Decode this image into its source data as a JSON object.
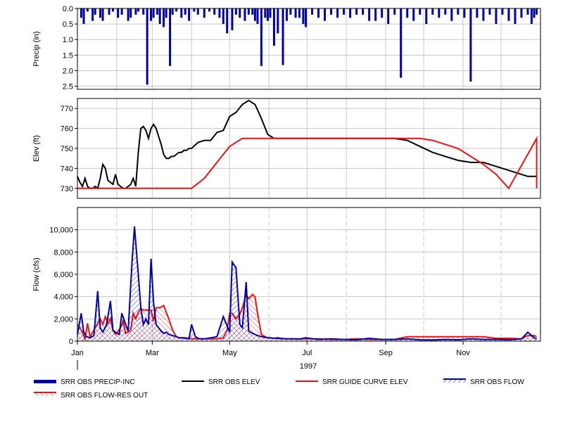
{
  "chart_data": [
    {
      "id": "precip",
      "type": "bar",
      "ylabel": "Precip (in)",
      "ylim": [
        0,
        2.6
      ],
      "y_inverted": true,
      "yticks": [
        "0.0",
        "0.5",
        "1.0",
        "1.5",
        "2.0",
        "2.5"
      ],
      "ytick_values": [
        0,
        0.5,
        1.0,
        1.5,
        2.0,
        2.5
      ],
      "grid": true,
      "color": "#0000a8",
      "series": [
        {
          "name": "SRR OBS PRECIP-INC",
          "x": [
            3,
            5,
            8,
            12,
            14,
            18,
            20,
            25,
            28,
            32,
            35,
            40,
            42,
            46,
            48,
            52,
            55,
            58,
            60,
            63,
            65,
            68,
            70,
            73,
            75,
            78,
            82,
            85,
            88,
            92,
            95,
            100,
            104,
            108,
            112,
            115,
            118,
            122,
            125,
            128,
            132,
            135,
            138,
            140,
            142,
            145,
            148,
            150,
            152,
            155,
            158,
            162,
            165,
            168,
            172,
            175,
            178,
            180,
            185,
            190,
            195,
            200,
            205,
            210,
            215,
            220,
            225,
            230,
            235,
            240,
            245,
            250,
            255,
            260,
            265,
            270,
            275,
            280,
            285,
            290,
            295,
            300,
            305,
            310,
            315,
            320,
            325,
            330,
            335,
            340,
            345,
            350,
            355,
            358,
            360,
            362
          ],
          "values": [
            0.3,
            0.5,
            0.1,
            0.4,
            0.2,
            0.3,
            0.4,
            0.2,
            0.1,
            0.3,
            0.2,
            0.4,
            0.3,
            0.2,
            0.1,
            0.2,
            2.45,
            0.4,
            0.3,
            0.2,
            0.5,
            0.6,
            0.3,
            1.85,
            0.2,
            0.1,
            0.3,
            0.2,
            0.4,
            0.1,
            0.2,
            0.3,
            0.1,
            0.2,
            0.3,
            0.5,
            0.8,
            0.7,
            0.2,
            0.3,
            0.4,
            0.2,
            0.2,
            0.4,
            0.5,
            1.85,
            0.3,
            0.4,
            0.3,
            1.2,
            0.8,
            1.82,
            0.4,
            0.2,
            0.3,
            0.3,
            0.5,
            0.6,
            0.2,
            0.3,
            0.4,
            0.2,
            0.3,
            0.2,
            0.3,
            0.2,
            0.2,
            0.4,
            0.4,
            0.3,
            0.5,
            0.2,
            2.23,
            0.3,
            0.4,
            0.2,
            0.5,
            0.2,
            0.3,
            0.2,
            0.4,
            0.2,
            0.3,
            2.35,
            0.3,
            0.4,
            0.2,
            0.5,
            0.2,
            0.4,
            0.5,
            0.3,
            0.2,
            0.5,
            0.3,
            0.2
          ]
        }
      ]
    },
    {
      "id": "elev",
      "type": "line",
      "ylabel": "Elev (ft)",
      "ylim": [
        725,
        775
      ],
      "yticks": [
        "730",
        "740",
        "750",
        "760",
        "770"
      ],
      "ytick_values": [
        730,
        740,
        750,
        760,
        770
      ],
      "grid": true,
      "series": [
        {
          "name": "SRR OBS ELEV",
          "color": "#000000",
          "x": [
            0,
            2,
            4,
            6,
            8,
            10,
            12,
            14,
            16,
            18,
            20,
            22,
            24,
            28,
            30,
            32,
            34,
            36,
            38,
            40,
            42,
            44,
            46,
            48,
            50,
            52,
            54,
            56,
            58,
            60,
            62,
            64,
            66,
            68,
            70,
            72,
            74,
            76,
            78,
            80,
            82,
            84,
            86,
            88,
            90,
            95,
            100,
            105,
            110,
            115,
            120,
            125,
            130,
            135,
            140,
            145,
            150,
            155,
            160,
            165,
            170,
            175,
            180,
            185,
            190,
            195,
            200,
            210,
            220,
            230,
            240,
            250,
            260,
            270,
            280,
            290,
            300,
            310,
            320,
            330,
            340,
            350,
            355,
            360,
            362
          ],
          "values": [
            736,
            733,
            731,
            735,
            731,
            730,
            730,
            731,
            730,
            735,
            742,
            740,
            734,
            732,
            737,
            732,
            731,
            730,
            730,
            731,
            732,
            735,
            731,
            748,
            760,
            761,
            759,
            755,
            760,
            762,
            760,
            756,
            752,
            747,
            745,
            745,
            746,
            746,
            747,
            748,
            748,
            749,
            749,
            750,
            750,
            753,
            754,
            754,
            758,
            759,
            766,
            768,
            772,
            774,
            772,
            765,
            757,
            755,
            755,
            755,
            755,
            755,
            755,
            755,
            755,
            755,
            755,
            755,
            755,
            755,
            755,
            755,
            754,
            751,
            748,
            746,
            744,
            743,
            743,
            741,
            739,
            737,
            736,
            736,
            736
          ]
        },
        {
          "name": "SRR GUIDE CURVE ELEV",
          "color": "#ee1111",
          "x": [
            0,
            90,
            100,
            110,
            120,
            130,
            135,
            362,
            270,
            280,
            300,
            320,
            330,
            340,
            362
          ],
          "values": [
            730,
            730,
            735,
            743,
            751,
            755,
            755,
            755,
            755,
            754,
            750,
            742,
            737,
            730,
            730
          ]
        }
      ]
    },
    {
      "id": "flow",
      "type": "area",
      "ylabel": "Flow (cfs)",
      "ylim": [
        0,
        12000
      ],
      "yticks": [
        "0",
        "2,000",
        "4,000",
        "6,000",
        "8,000",
        "10,000"
      ],
      "ytick_values": [
        0,
        2000,
        4000,
        6000,
        8000,
        10000
      ],
      "grid": true,
      "x_categories": [
        "Jan",
        "Mar",
        "May",
        "Jul",
        "Sep",
        "Nov"
      ],
      "year": "1997",
      "series": [
        {
          "name": "SRR OBS FLOW",
          "color": "#0000a8",
          "x": [
            0,
            3,
            5,
            7,
            10,
            13,
            16,
            18,
            20,
            23,
            26,
            28,
            30,
            33,
            35,
            38,
            40,
            43,
            45,
            48,
            50,
            52,
            54,
            56,
            58,
            60,
            62,
            64,
            66,
            68,
            70,
            72,
            75,
            78,
            80,
            82,
            85,
            88,
            90,
            93,
            96,
            100,
            105,
            110,
            115,
            120,
            122,
            125,
            128,
            130,
            133,
            135,
            138,
            140,
            142,
            145,
            148,
            150,
            152,
            155,
            158,
            160,
            165,
            170,
            175,
            180,
            190,
            200,
            210,
            220,
            230,
            240,
            250,
            260,
            270,
            280,
            290,
            300,
            310,
            320,
            330,
            340,
            350,
            355,
            360,
            362
          ],
          "values": [
            600,
            2500,
            800,
            400,
            300,
            500,
            4500,
            1200,
            800,
            1500,
            3600,
            1000,
            800,
            600,
            2500,
            1500,
            900,
            7000,
            10300,
            6000,
            3000,
            1500,
            2000,
            1500,
            7400,
            3500,
            1500,
            1200,
            900,
            700,
            800,
            600,
            500,
            400,
            300,
            300,
            250,
            200,
            1500,
            400,
            200,
            200,
            300,
            400,
            2200,
            800,
            7100,
            6600,
            1500,
            1200,
            5300,
            900,
            700,
            600,
            500,
            400,
            350,
            300,
            300,
            250,
            300,
            250,
            200,
            200,
            180,
            300,
            150,
            200,
            150,
            120,
            250,
            150,
            150,
            200,
            120,
            100,
            150,
            120,
            200,
            150,
            150,
            120,
            200,
            800,
            300,
            200
          ]
        },
        {
          "name": "SRR OBS FLOW-RES OUT",
          "color": "#ee1111",
          "x": [
            0,
            2,
            4,
            6,
            8,
            10,
            14,
            18,
            20,
            22,
            24,
            26,
            28,
            30,
            32,
            34,
            36,
            38,
            40,
            42,
            44,
            46,
            48,
            50,
            52,
            55,
            58,
            60,
            62,
            65,
            68,
            70,
            72,
            75,
            78,
            80,
            85,
            90,
            100,
            110,
            115,
            118,
            120,
            122,
            125,
            128,
            130,
            133,
            135,
            138,
            140,
            142,
            145,
            148,
            150,
            155,
            160,
            170,
            180,
            190,
            200,
            210,
            220,
            230,
            240,
            250,
            260,
            270,
            290,
            300,
            310,
            320,
            330,
            340,
            350,
            355,
            360,
            362
          ],
          "values": [
            1500,
            1200,
            800,
            200,
            1600,
            400,
            1200,
            2000,
            1500,
            2200,
            1600,
            2000,
            1000,
            600,
            900,
            1200,
            1800,
            700,
            800,
            1000,
            2500,
            2000,
            2600,
            2900,
            2800,
            2800,
            2800,
            1800,
            3000,
            3000,
            3200,
            2600,
            2000,
            1000,
            400,
            300,
            300,
            200,
            200,
            200,
            300,
            1000,
            2500,
            2500,
            2000,
            2400,
            3000,
            4200,
            3800,
            4200,
            4000,
            2500,
            600,
            400,
            300,
            250,
            200,
            200,
            200,
            200,
            150,
            150,
            200,
            150,
            150,
            150,
            400,
            400,
            400,
            400,
            400,
            400,
            250,
            250,
            200,
            500,
            500,
            400
          ]
        }
      ]
    }
  ],
  "legend": [
    {
      "label": "SRR OBS PRECIP-INC",
      "color": "#0000a8"
    },
    {
      "label": "SRR OBS ELEV",
      "color": "#000000"
    },
    {
      "label": "SRR GUIDE CURVE ELEV",
      "color": "#ee1111"
    },
    {
      "label": "SRR OBS FLOW",
      "color": "#0000a8"
    },
    {
      "label": "SRR OBS FLOW-RES OUT",
      "color": "#ee1111"
    }
  ]
}
